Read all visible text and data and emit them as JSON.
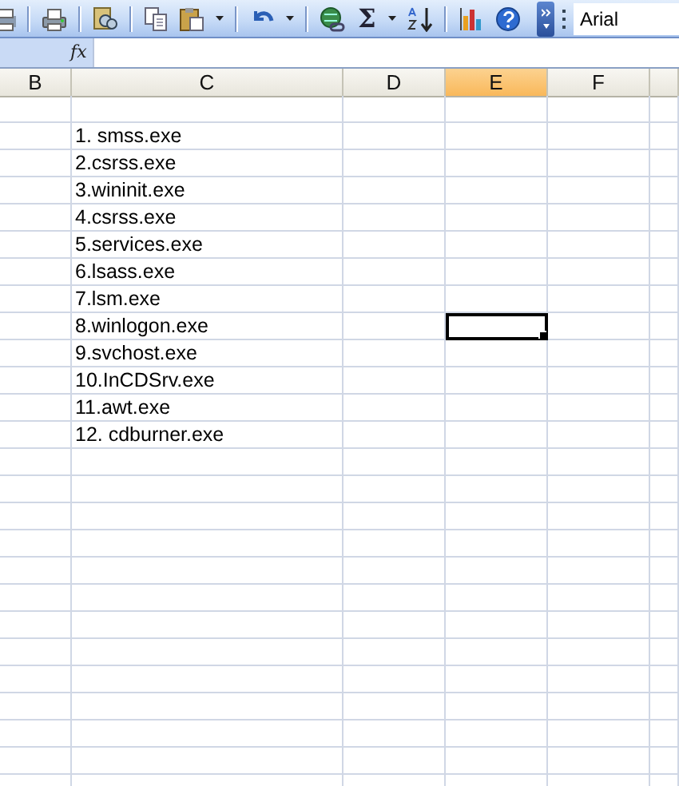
{
  "toolbar": {
    "autosum_label": "Σ",
    "font_field": {
      "value": "Arial"
    }
  },
  "formula_bar": {
    "function_label": "fx"
  },
  "columns": [
    {
      "label": "B",
      "selected": false
    },
    {
      "label": "C",
      "selected": false
    },
    {
      "label": "D",
      "selected": false
    },
    {
      "label": "E",
      "selected": true
    },
    {
      "label": "F",
      "selected": false
    }
  ],
  "rows": [
    {
      "cell_c": "1. smss.exe",
      "active_cell_e": false
    },
    {
      "cell_c": "2.csrss.exe",
      "active_cell_e": false
    },
    {
      "cell_c": "3.wininit.exe",
      "active_cell_e": false
    },
    {
      "cell_c": "4.csrss.exe",
      "active_cell_e": false
    },
    {
      "cell_c": "5.services.exe",
      "active_cell_e": false
    },
    {
      "cell_c": "6.lsass.exe",
      "active_cell_e": false
    },
    {
      "cell_c": "7.lsm.exe",
      "active_cell_e": false
    },
    {
      "cell_c": "8.winlogon.exe",
      "active_cell_e": true
    },
    {
      "cell_c": "9.svchost.exe",
      "active_cell_e": false
    },
    {
      "cell_c": "10.InCDSrv.exe",
      "active_cell_e": false
    },
    {
      "cell_c": "11.awt.exe",
      "active_cell_e": false
    },
    {
      "cell_c": "12. cdburner.exe",
      "active_cell_e": false
    }
  ]
}
